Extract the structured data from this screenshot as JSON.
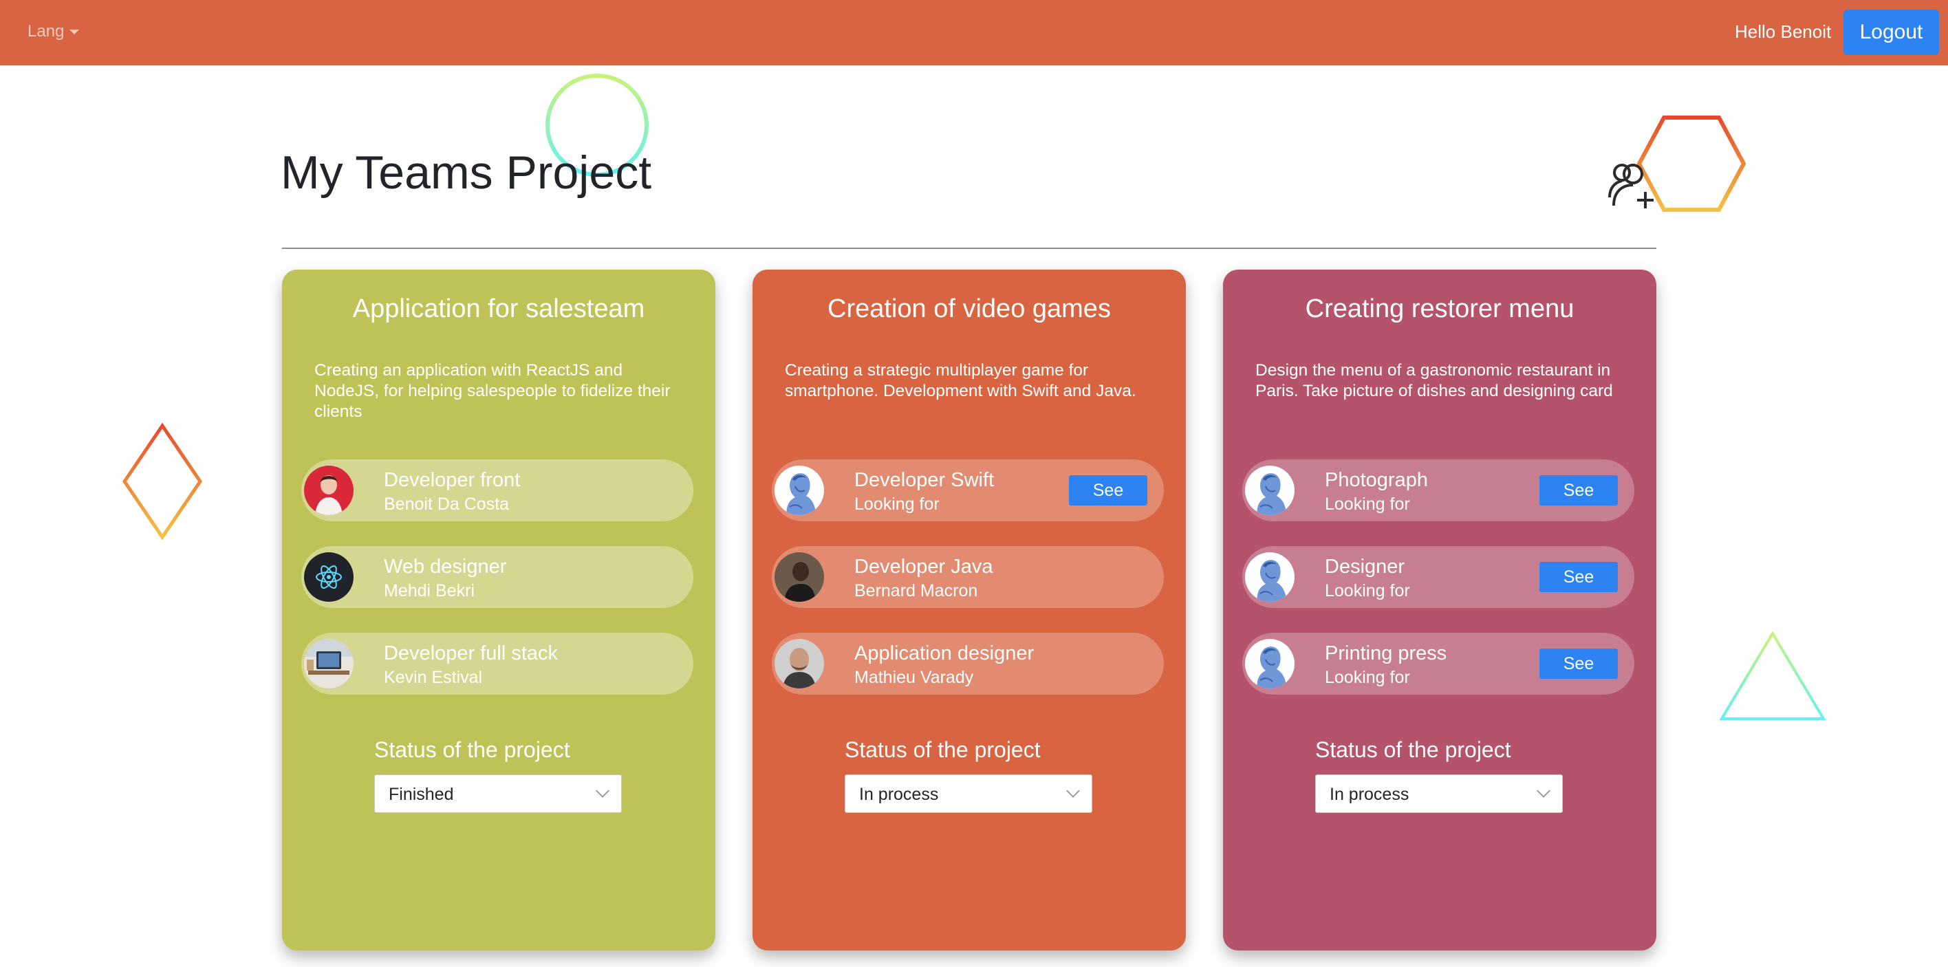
{
  "navbar": {
    "lang_label": "Lang",
    "greeting": "Hello Benoit",
    "logout_label": "Logout",
    "background": "#d96441"
  },
  "page": {
    "title": "My Teams Project"
  },
  "colors": {
    "card_green": "#bfc256",
    "card_orange": "#d96441",
    "card_rose": "#b5536b",
    "button_blue": "#2c83f1"
  },
  "projects": [
    {
      "title": "Application for salesteam",
      "description": "Creating an application with ReactJS and NodeJS, for helping salespeople to fidelize their clients",
      "members": [
        {
          "role": "Developer front",
          "name": "Benoit Da Costa",
          "avatar": "portrait-red"
        },
        {
          "role": "Web designer",
          "name": "Mehdi Bekri",
          "avatar": "react-logo"
        },
        {
          "role": "Developer full stack",
          "name": "Kevin Estival",
          "avatar": "desk-photo"
        }
      ],
      "status_label": "Status of the project",
      "status_value": "Finished"
    },
    {
      "title": "Creation of video games",
      "description": "Creating a strategic multiplayer game for smartphone. Development with Swift and Java.",
      "members": [
        {
          "role": "Developer Swift",
          "name": "Looking for",
          "avatar": "placeholder-bust",
          "see_label": "See"
        },
        {
          "role": "Developer Java",
          "name": "Bernard Macron",
          "avatar": "portrait-dark"
        },
        {
          "role": "Application designer",
          "name": "Mathieu Varady",
          "avatar": "portrait-bald"
        }
      ],
      "status_label": "Status of the project",
      "status_value": "In process"
    },
    {
      "title": "Creating restorer menu",
      "description": "Design the menu of a gastronomic restaurant in Paris. Take picture of dishes and designing card",
      "members": [
        {
          "role": "Photograph",
          "name": "Looking for",
          "avatar": "placeholder-bust",
          "see_label": "See"
        },
        {
          "role": "Designer",
          "name": "Looking for",
          "avatar": "placeholder-bust",
          "see_label": "See"
        },
        {
          "role": "Printing press",
          "name": "Looking for",
          "avatar": "placeholder-bust",
          "see_label": "See"
        }
      ],
      "status_label": "Status of the project",
      "status_value": "In process"
    }
  ]
}
